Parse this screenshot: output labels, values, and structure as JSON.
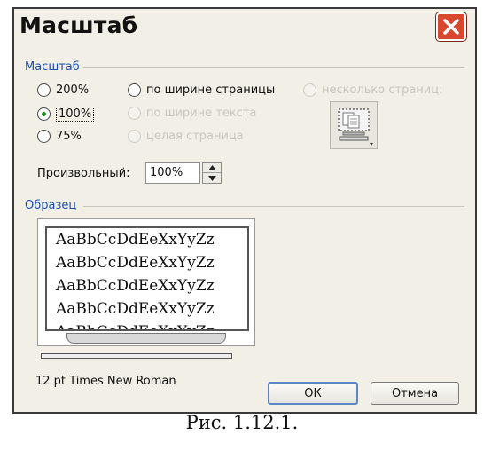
{
  "dialog": {
    "title": "Масштаб",
    "close_icon": "close-icon"
  },
  "zoom_group": {
    "label": "Масштаб",
    "options": [
      {
        "label": "200%",
        "checked": false,
        "enabled": true
      },
      {
        "label": "100%",
        "checked": true,
        "enabled": true
      },
      {
        "label": "75%",
        "checked": false,
        "enabled": true
      },
      {
        "label": "по ширине страницы",
        "checked": false,
        "enabled": true
      },
      {
        "label": "по ширине текста",
        "checked": false,
        "enabled": false
      },
      {
        "label": "целая страница",
        "checked": false,
        "enabled": false
      },
      {
        "label": "несколько страниц:",
        "checked": false,
        "enabled": false
      }
    ],
    "pages_button_icon": "monitor-pages-icon",
    "custom_label": "Произвольный:",
    "custom_value": "100%"
  },
  "sample_group": {
    "label": "Образец",
    "lines": [
      "AaBbCcDdEeXxYyZz",
      "AaBbCcDdEeXxYyZz",
      "AaBbCcDdEeXxYyZz",
      "AaBbCcDdEeXxYyZz",
      "AaBbCcDdEeXxYyZz"
    ],
    "font_note": "12 pt Times New Roman"
  },
  "buttons": {
    "ok": "ОК",
    "cancel": "Отмена"
  },
  "caption": "Рис. 1.12.1.",
  "colors": {
    "group_label": "#1d4fb3",
    "close_button": "#d8482f",
    "dialog_bg": "#f1efe6"
  }
}
